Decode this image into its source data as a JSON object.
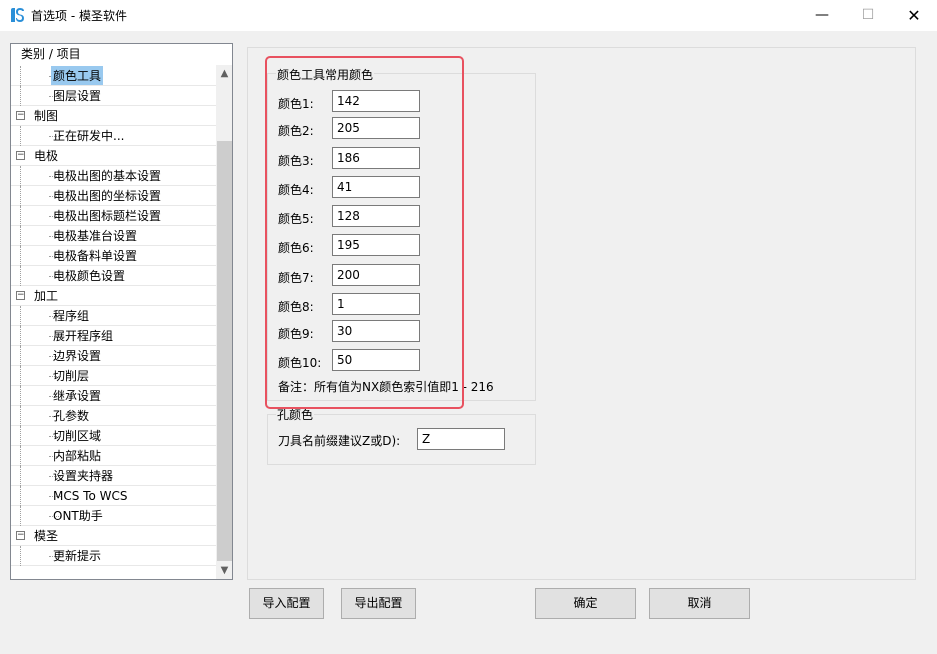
{
  "window": {
    "title": "首选项 - 模圣软件"
  },
  "tree": {
    "header": "类别 / 项目",
    "rows": [
      {
        "label": "颜色工具",
        "level": 1,
        "selected": true
      },
      {
        "label": "图层设置",
        "level": 1
      },
      {
        "label": "制图",
        "level": 0
      },
      {
        "label": "正在研发中...",
        "level": 1
      },
      {
        "label": "电极",
        "level": 0
      },
      {
        "label": "电极出图的基本设置",
        "level": 1
      },
      {
        "label": "电极出图的坐标设置",
        "level": 1
      },
      {
        "label": "电极出图标题栏设置",
        "level": 1
      },
      {
        "label": "电极基准台设置",
        "level": 1
      },
      {
        "label": "电极备料单设置",
        "level": 1
      },
      {
        "label": "电极颜色设置",
        "level": 1
      },
      {
        "label": "加工",
        "level": 0
      },
      {
        "label": "程序组",
        "level": 1
      },
      {
        "label": "展开程序组",
        "level": 1
      },
      {
        "label": "边界设置",
        "level": 1
      },
      {
        "label": "切削层",
        "level": 1
      },
      {
        "label": "继承设置",
        "level": 1
      },
      {
        "label": "孔参数",
        "level": 1
      },
      {
        "label": "切削区域",
        "level": 1
      },
      {
        "label": "内部粘贴",
        "level": 1
      },
      {
        "label": "设置夹持器",
        "level": 1
      },
      {
        "label": "MCS To WCS",
        "level": 1
      },
      {
        "label": "ONT助手",
        "level": 1
      },
      {
        "label": "模圣",
        "level": 0
      },
      {
        "label": "更新提示",
        "level": 1
      }
    ]
  },
  "color_group": {
    "title": "颜色工具常用颜色",
    "fields": [
      {
        "label": "颜色1:",
        "value": "142"
      },
      {
        "label": "颜色2:",
        "value": "205"
      },
      {
        "label": "颜色3:",
        "value": "186"
      },
      {
        "label": "颜色4:",
        "value": "41"
      },
      {
        "label": "颜色5:",
        "value": "128"
      },
      {
        "label": "颜色6:",
        "value": "195"
      },
      {
        "label": "颜色7:",
        "value": "200"
      },
      {
        "label": "颜色8:",
        "value": "1"
      },
      {
        "label": "颜色9:",
        "value": "30"
      },
      {
        "label": "颜色10:",
        "value": "50"
      }
    ],
    "note": "备注：所有值为NX颜色索引值即1 - 216"
  },
  "hole_group": {
    "title": "孔颜色",
    "label": "刀具名前缀建议Z或D):",
    "value": "Z"
  },
  "buttons": {
    "import": "导入配置",
    "export": "导出配置",
    "ok": "确定",
    "cancel": "取消"
  },
  "colors": {
    "highlight": "#e8515f",
    "selection": "#99c9ef",
    "app_icon": "#2a8fd8"
  }
}
